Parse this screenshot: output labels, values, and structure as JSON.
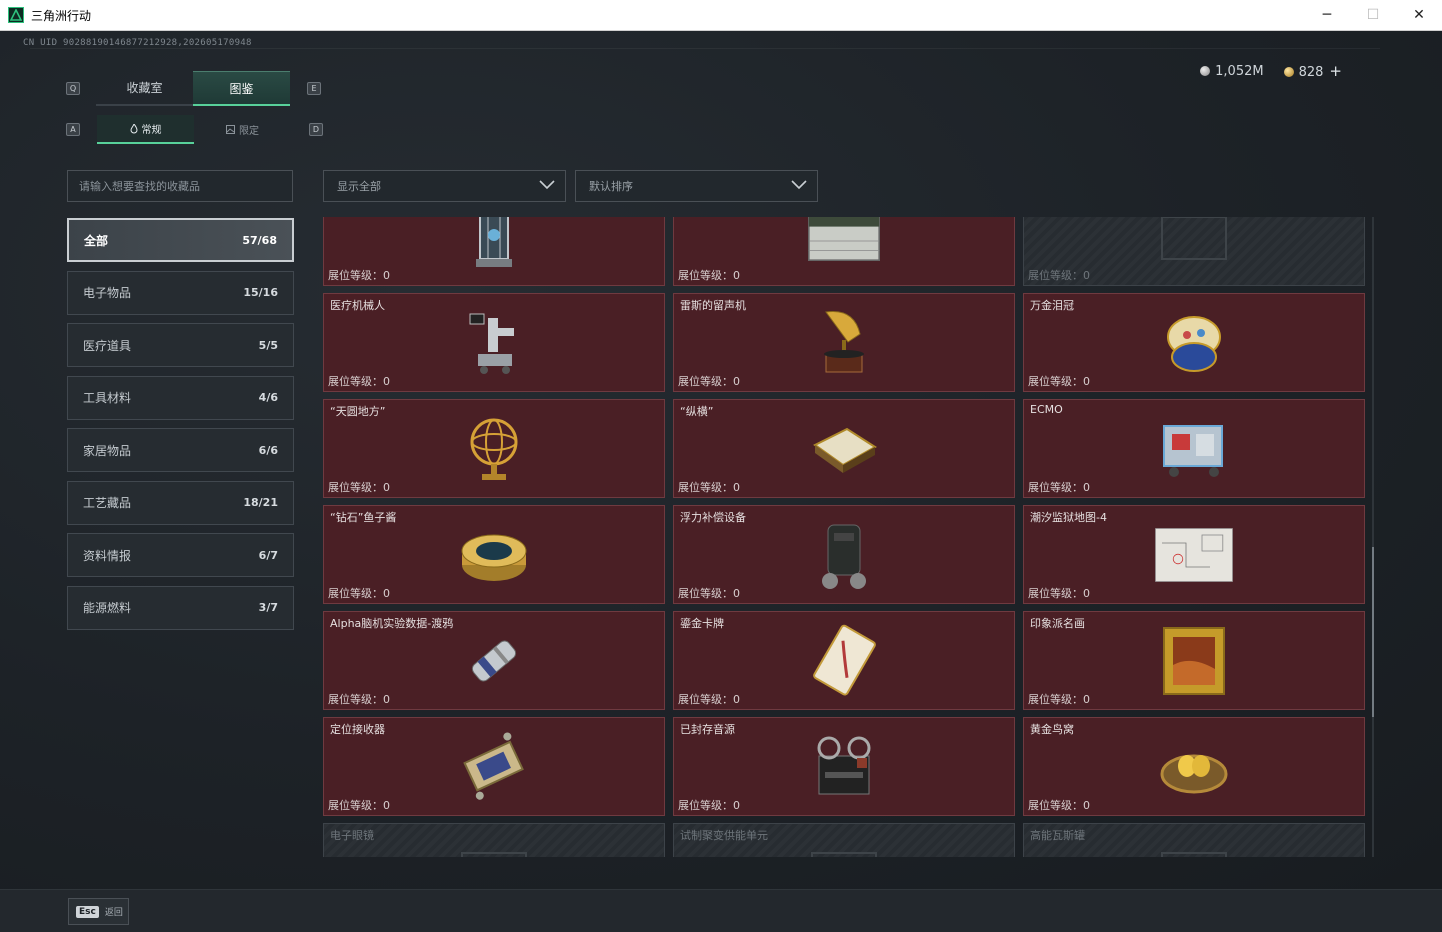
{
  "window": {
    "title": "三角洲行动",
    "minimize": "─",
    "maximize": "☐",
    "close": "✕"
  },
  "uid": "CN UID 9028819014687721292​8,202605170948",
  "currency": {
    "silver": "1,052M",
    "gold": "828",
    "plus": "+"
  },
  "keys": {
    "left_tab": "Q",
    "right_tab": "E",
    "left_sub": "A",
    "right_sub": "D"
  },
  "tabs": [
    {
      "label": "收藏室"
    },
    {
      "label": "图鉴"
    }
  ],
  "subtabs": [
    {
      "label": "常规"
    },
    {
      "label": "限定"
    }
  ],
  "search": {
    "placeholder": "请输入想要查找的收藏品"
  },
  "filters": {
    "show": "显示全部",
    "sort": "默认排序"
  },
  "categories": [
    {
      "label": "全部",
      "count": "57/68"
    },
    {
      "label": "电子物品",
      "count": "15/16"
    },
    {
      "label": "医疗道具",
      "count": "5/5"
    },
    {
      "label": "工具材料",
      "count": "4/6"
    },
    {
      "label": "家居物品",
      "count": "6/6"
    },
    {
      "label": "工艺藏品",
      "count": "18/21"
    },
    {
      "label": "资料情报",
      "count": "6/7"
    },
    {
      "label": "能源燃料",
      "count": "3/7"
    }
  ],
  "level_label": "展位等级：",
  "level_value": "0",
  "items": [
    {
      "name": "",
      "icon": "lantern-icon"
    },
    {
      "name": "",
      "icon": "crate-icon"
    },
    {
      "name": "",
      "icon": "locked-icon"
    },
    {
      "name": "医疗机械人",
      "icon": "robot-arm-icon"
    },
    {
      "name": "雷斯的留声机",
      "icon": "gramophone-icon"
    },
    {
      "name": "万金泪冠",
      "icon": "jewel-egg-icon"
    },
    {
      "name": "“天圆地方”",
      "icon": "armillary-icon"
    },
    {
      "name": "“纵横”",
      "icon": "chessboard-icon"
    },
    {
      "name": "ECMO",
      "icon": "machine-icon"
    },
    {
      "name": "“钻石”鱼子酱",
      "icon": "caviar-tin-icon"
    },
    {
      "name": "浮力补偿设备",
      "icon": "bcd-vest-icon"
    },
    {
      "name": "潮汐监狱地图-4",
      "icon": "map-icon"
    },
    {
      "name": "Alpha脑机实验数据-渡鸦",
      "icon": "data-cylinder-icon"
    },
    {
      "name": "鎏金卡牌",
      "icon": "card-icon"
    },
    {
      "name": "印象派名画",
      "icon": "painting-icon"
    },
    {
      "name": "定位接收器",
      "icon": "receiver-icon"
    },
    {
      "name": "已封存音源",
      "icon": "reel-recorder-icon"
    },
    {
      "name": "黄金鸟窝",
      "icon": "golden-nest-icon"
    },
    {
      "name": "电子眼镜",
      "icon": "locked-icon"
    },
    {
      "name": "试制聚变供能单元",
      "icon": "locked-icon"
    },
    {
      "name": "高能瓦斯罐",
      "icon": "locked-icon"
    }
  ],
  "bottom": {
    "esc_key": "Esc",
    "esc_label": "返回"
  }
}
